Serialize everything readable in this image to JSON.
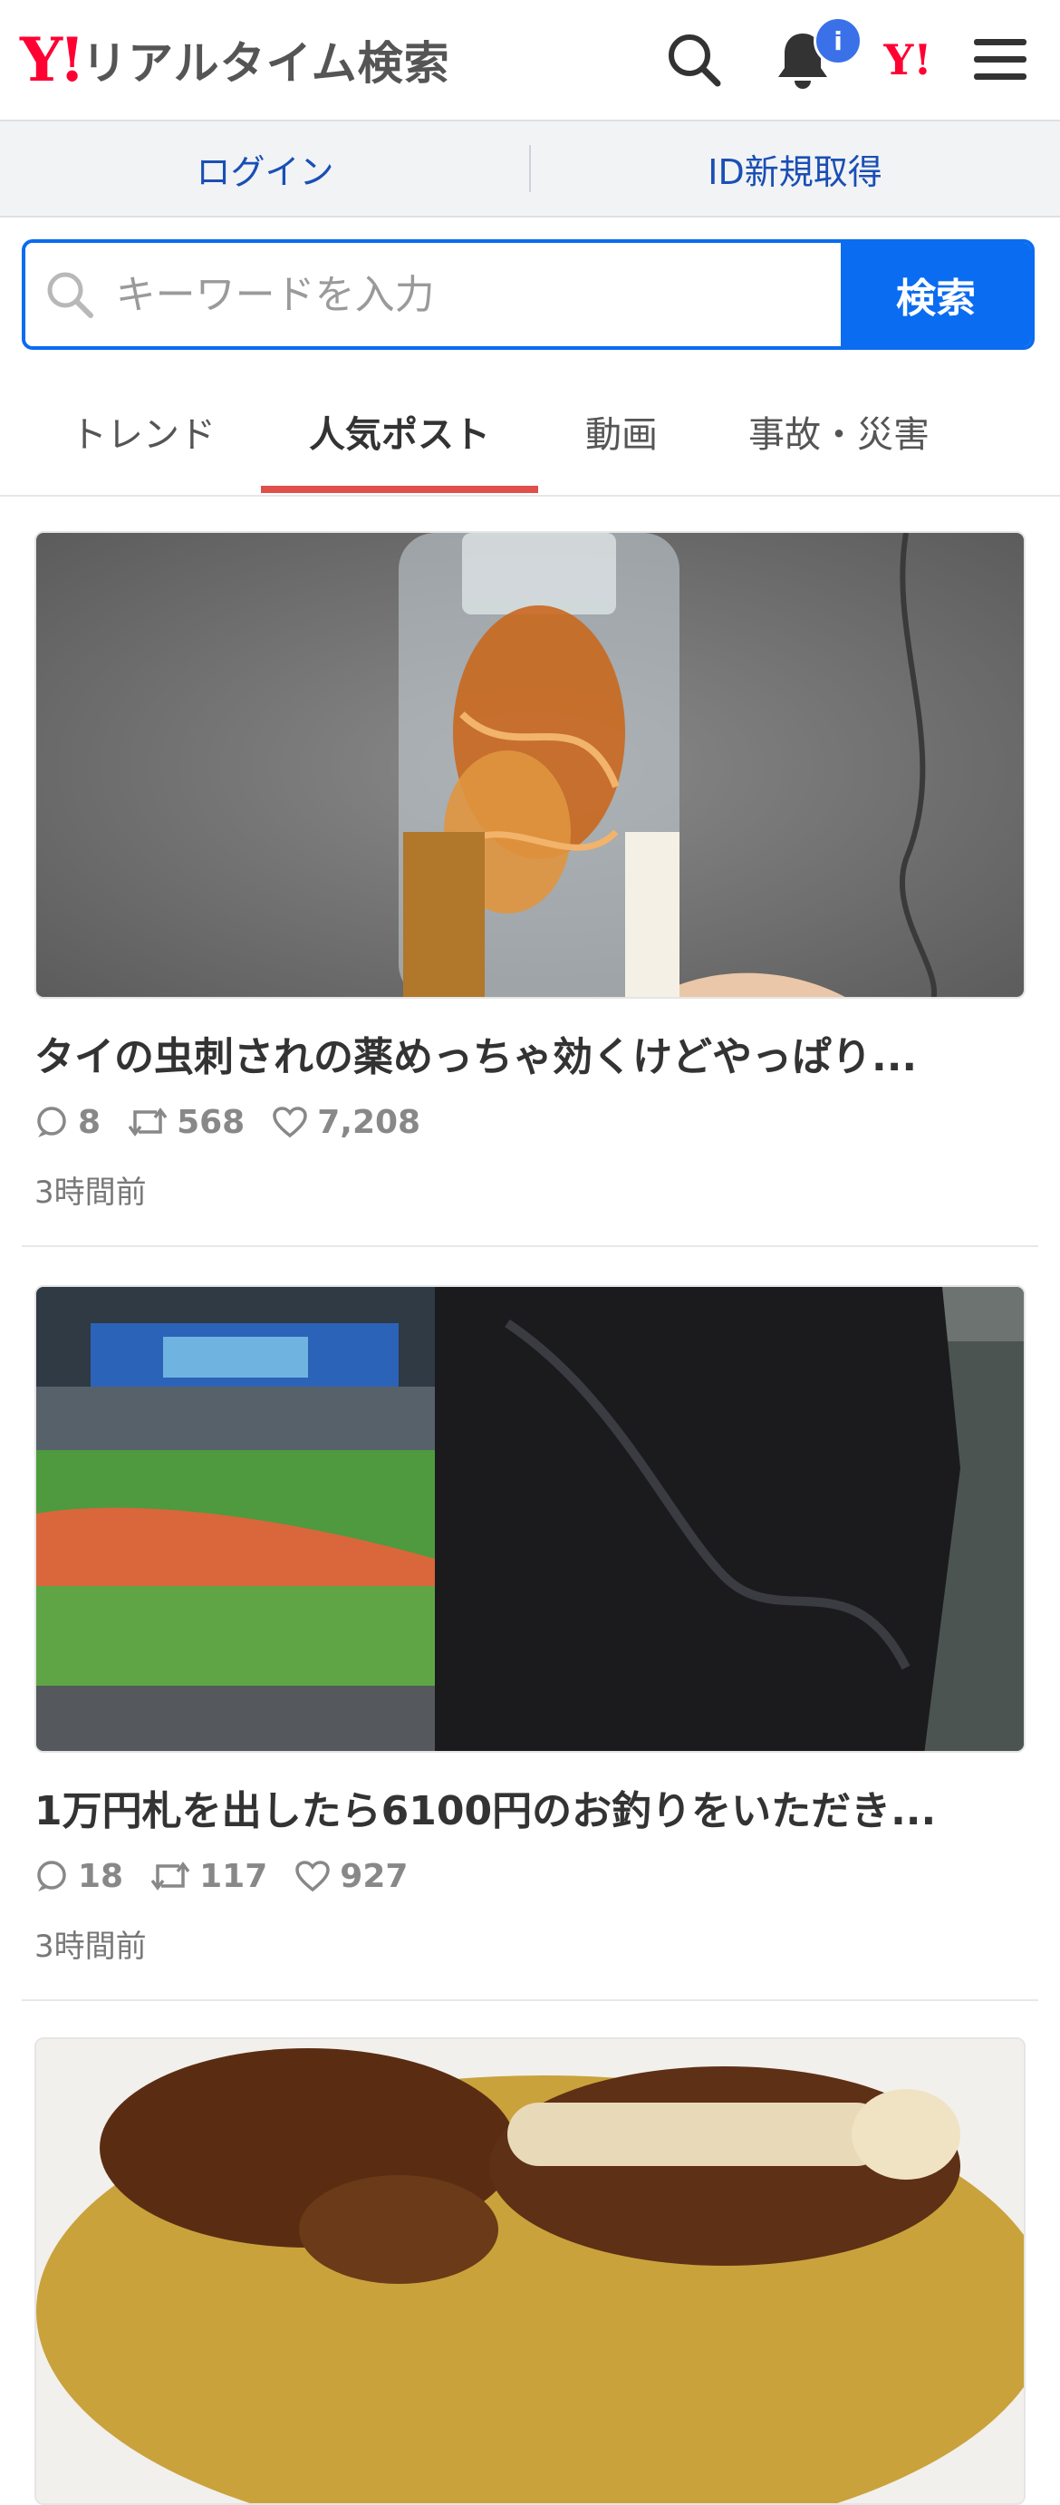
{
  "header": {
    "logo_mark": "Y!",
    "logo_text": "リアルタイム検索",
    "notification_badge": "i",
    "yj_label": "Y!"
  },
  "login_bar": {
    "login_label": "ログイン",
    "signup_label": "ID新規取得"
  },
  "search": {
    "placeholder": "キーワードを入力",
    "value": "",
    "button_label": "検索"
  },
  "tabs": [
    {
      "label": "トレンド",
      "active": false
    },
    {
      "label": "人気ポスト",
      "active": true
    },
    {
      "label": "動画",
      "active": false
    },
    {
      "label": "事故・災害",
      "active": false
    }
  ],
  "posts": [
    {
      "title": "タイの虫刺されの薬めっちゃ効くけどやっぱり...",
      "replies": "8",
      "reposts": "568",
      "likes": "7,208",
      "time": "3時間前"
    },
    {
      "title": "1万円札を出したら6100円のお釣りをいただき...",
      "replies": "18",
      "reposts": "117",
      "likes": "927",
      "time": "3時間前"
    },
    {
      "title": "",
      "replies": "",
      "reposts": "",
      "likes": "",
      "time": ""
    }
  ],
  "colors": {
    "brand_red": "#ff0033",
    "accent_blue": "#0a6cf0",
    "tab_underline": "#e0504b",
    "badge_blue": "#3b71e8",
    "link_blue": "#1a4fb5"
  }
}
